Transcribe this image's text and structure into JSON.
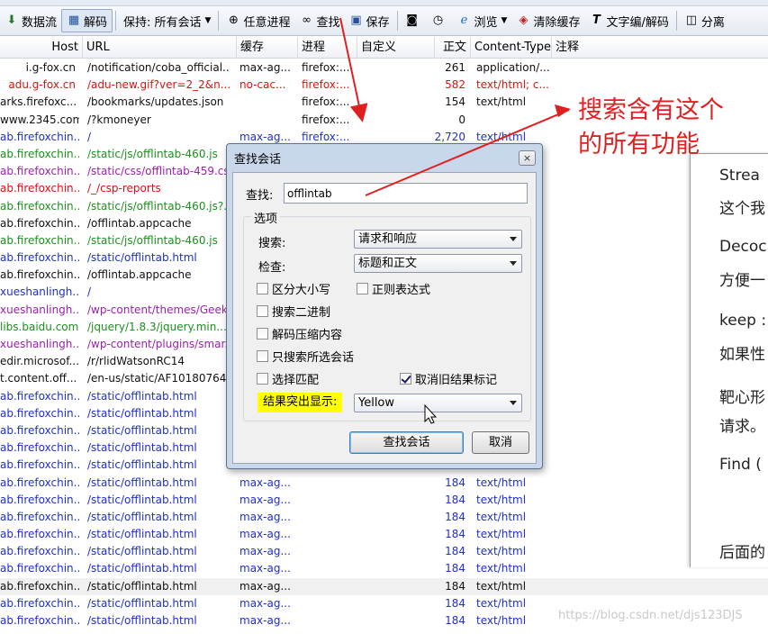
{
  "toolbar": {
    "items": [
      {
        "label": "数据流",
        "icon": "stream-icon"
      },
      {
        "label": "解码",
        "icon": "decode-icon",
        "pressed": true
      },
      {
        "label": "保持: 所有会话",
        "icon": "",
        "dropdown": true
      },
      {
        "label": "任意进程",
        "icon": "crosshair-icon"
      },
      {
        "label": "查找",
        "icon": "binoculars-icon"
      },
      {
        "label": "保存",
        "icon": "save-icon"
      },
      {
        "label": "",
        "icon": "camera-icon"
      },
      {
        "label": "",
        "icon": "timer-icon"
      },
      {
        "label": "浏览",
        "icon": "browser-icon",
        "dropdown": true
      },
      {
        "label": "清除缓存",
        "icon": "clear-cache-icon"
      },
      {
        "label": "文字编/解码",
        "icon": "text-wizard-icon"
      },
      {
        "label": "分离",
        "icon": "tearoff-icon"
      }
    ]
  },
  "columns": [
    "Host",
    "URL",
    "缓存",
    "进程",
    "自定义",
    "正文",
    "Content-Type",
    "注释"
  ],
  "rows": [
    {
      "host": "i.g-fox.cn",
      "url": "/notification/coba_official...",
      "cache": "max-ag...",
      "proc": "firefox:...",
      "body": "261",
      "ctype": "application/...",
      "color": "black"
    },
    {
      "host": "adu.g-fox.cn",
      "url": "/adu-new.gif?ver=2_2&n...",
      "cache": "no-cac...",
      "proc": "firefox:...",
      "body": "582",
      "ctype": "text/html; c...",
      "color": "red"
    },
    {
      "host": "arks.firefoxc...",
      "url": "/bookmarks/updates.json",
      "cache": "",
      "proc": "firefox:...",
      "body": "154",
      "ctype": "text/html",
      "color": "black"
    },
    {
      "host": "www.2345.com",
      "url": "/?kmoneyer",
      "cache": "",
      "proc": "firefox:...",
      "body": "0",
      "ctype": "",
      "color": "black"
    },
    {
      "host": "ab.firefoxchin...",
      "url": "/",
      "cache": "max-ag...",
      "proc": "firefox:...",
      "body": "2,720",
      "ctype": "text/html",
      "color": "blue"
    },
    {
      "host": "ab.firefoxchin...",
      "url": "/static/js/offlintab-460.js",
      "cache": "",
      "proc": "",
      "body": "",
      "ctype": "",
      "color": "green"
    },
    {
      "host": "ab.firefoxchin...",
      "url": "/static/css/offlintab-459.css",
      "cache": "",
      "proc": "",
      "body": "",
      "ctype": "",
      "color": "purple"
    },
    {
      "host": "ab.firefoxchin...",
      "url": "/_/csp-reports",
      "cache": "",
      "proc": "",
      "body": "",
      "ctype": "",
      "color": "red"
    },
    {
      "host": "ab.firefoxchin...",
      "url": "/static/js/offlintab-460.js?...",
      "cache": "",
      "proc": "",
      "body": "",
      "ctype": "",
      "color": "green"
    },
    {
      "host": "ab.firefoxchin...",
      "url": "/offlintab.appcache",
      "cache": "",
      "proc": "",
      "body": "",
      "ctype": "",
      "color": "black"
    },
    {
      "host": "ab.firefoxchin...",
      "url": "/static/js/offlintab-460.js",
      "cache": "",
      "proc": "",
      "body": "",
      "ctype": "",
      "color": "green"
    },
    {
      "host": "ab.firefoxchin...",
      "url": "/static/offlintab.html",
      "cache": "",
      "proc": "",
      "body": "",
      "ctype": "",
      "color": "blue"
    },
    {
      "host": "ab.firefoxchin...",
      "url": "/offlintab.appcache",
      "cache": "",
      "proc": "",
      "body": "",
      "ctype": "",
      "color": "black"
    },
    {
      "host": "xueshanlingh...",
      "url": "/",
      "cache": "",
      "proc": "",
      "body": "",
      "ctype": "",
      "color": "blue"
    },
    {
      "host": "xueshanlingh...",
      "url": "/wp-content/themes/Geek...",
      "cache": "",
      "proc": "",
      "body": "",
      "ctype": "",
      "color": "purple"
    },
    {
      "host": "libs.baidu.com",
      "url": "/jquery/1.8.3/jquery.min....",
      "cache": "",
      "proc": "",
      "body": "",
      "ctype": "",
      "color": "green"
    },
    {
      "host": "xueshanlingh...",
      "url": "/wp-content/plugins/smar...",
      "cache": "",
      "proc": "",
      "body": "",
      "ctype": "",
      "color": "purple"
    },
    {
      "host": "edir.microsof...",
      "url": "/r/rlidWatsonRC14",
      "cache": "",
      "proc": "",
      "body": "",
      "ctype": "",
      "color": "black"
    },
    {
      "host": "t.content.off...",
      "url": "/en-us/static/AF10180764...",
      "cache": "",
      "proc": "",
      "body": "",
      "ctype": "",
      "color": "black"
    },
    {
      "host": "ab.firefoxchin...",
      "url": "/static/offlintab.html",
      "cache": "",
      "proc": "",
      "body": "",
      "ctype": "",
      "color": "blue"
    },
    {
      "host": "ab.firefoxchin...",
      "url": "/static/offlintab.html",
      "cache": "",
      "proc": "",
      "body": "",
      "ctype": "",
      "color": "blue"
    },
    {
      "host": "ab.firefoxchin...",
      "url": "/static/offlintab.html",
      "cache": "",
      "proc": "",
      "body": "",
      "ctype": "",
      "color": "blue"
    },
    {
      "host": "ab.firefoxchin...",
      "url": "/static/offlintab.html",
      "cache": "",
      "proc": "",
      "body": "",
      "ctype": "",
      "color": "blue"
    },
    {
      "host": "ab.firefoxchin...",
      "url": "/static/offlintab.html",
      "cache": "",
      "proc": "",
      "body": "",
      "ctype": "",
      "color": "blue"
    },
    {
      "host": "ab.firefoxchin...",
      "url": "/static/offlintab.html",
      "cache": "max-ag...",
      "proc": "",
      "body": "184",
      "ctype": "text/html",
      "color": "blue"
    },
    {
      "host": "ab.firefoxchin...",
      "url": "/static/offlintab.html",
      "cache": "max-ag...",
      "proc": "",
      "body": "184",
      "ctype": "text/html",
      "color": "blue"
    },
    {
      "host": "ab.firefoxchin...",
      "url": "/static/offlintab.html",
      "cache": "max-ag...",
      "proc": "",
      "body": "184",
      "ctype": "text/html",
      "color": "blue"
    },
    {
      "host": "ab.firefoxchin...",
      "url": "/static/offlintab.html",
      "cache": "max-ag...",
      "proc": "",
      "body": "184",
      "ctype": "text/html",
      "color": "blue"
    },
    {
      "host": "ab.firefoxchin...",
      "url": "/static/offlintab.html",
      "cache": "max-ag...",
      "proc": "",
      "body": "184",
      "ctype": "text/html",
      "color": "blue"
    },
    {
      "host": "ab.firefoxchin...",
      "url": "/static/offlintab.html",
      "cache": "max-ag...",
      "proc": "",
      "body": "184",
      "ctype": "text/html",
      "color": "blue"
    },
    {
      "host": "ab.firefoxchin...",
      "url": "/static/offlintab.html",
      "cache": "max-ag...",
      "proc": "",
      "body": "184",
      "ctype": "text/html",
      "color": "black",
      "selected": true
    },
    {
      "host": "ab.firefoxchin...",
      "url": "/static/offlintab.html",
      "cache": "max-ag...",
      "proc": "",
      "body": "184",
      "ctype": "text/html",
      "color": "blue"
    },
    {
      "host": "ab.firefoxchin...",
      "url": "/static/offlintab.html",
      "cache": "max-ag...",
      "proc": "",
      "body": "184",
      "ctype": "text/html",
      "color": "blue"
    }
  ],
  "row_colors": {
    "black": "#111111",
    "red": "#dd1111",
    "green": "#1e8e1e",
    "blue": "#1f2fd0",
    "purple": "#9b1fb0"
  },
  "side_panel": {
    "lines": [
      "Strea",
      "这个我",
      "Decoc",
      "方便一",
      "keep :",
      "如果性",
      "靶心形",
      "请求。",
      "Find (",
      "后面的"
    ]
  },
  "dialog": {
    "title": "查找会话",
    "close_label": "×",
    "find_label": "查找:",
    "find_value": "offlintab",
    "options_title": "选项",
    "search_label": "搜索:",
    "search_value": "请求和响应",
    "examine_label": "检查:",
    "examine_value": "标题和正文",
    "checkboxes": {
      "match_case": {
        "label": "区分大小写",
        "checked": false
      },
      "regex": {
        "label": "正则表达式",
        "checked": false
      },
      "search_binaries": {
        "label": "搜索二进制",
        "checked": false
      },
      "decode_compressed": {
        "label": "解码压缩内容",
        "checked": false
      },
      "search_selected_only": {
        "label": "只搜索所选会话",
        "checked": false
      },
      "select_matches": {
        "label": "选择匹配",
        "checked": false
      },
      "unmark_old_results": {
        "label": "取消旧结果标记",
        "checked": true
      }
    },
    "highlight_label": "结果突出显示:",
    "highlight_value": "Yellow",
    "find_button": "查找会话",
    "cancel_button": "取消"
  },
  "annotation": {
    "line1": "搜索含有这个",
    "line2": "的所有功能",
    "color": "#e02020"
  },
  "watermark": "https://blog.csdn.net/djs123DJS"
}
